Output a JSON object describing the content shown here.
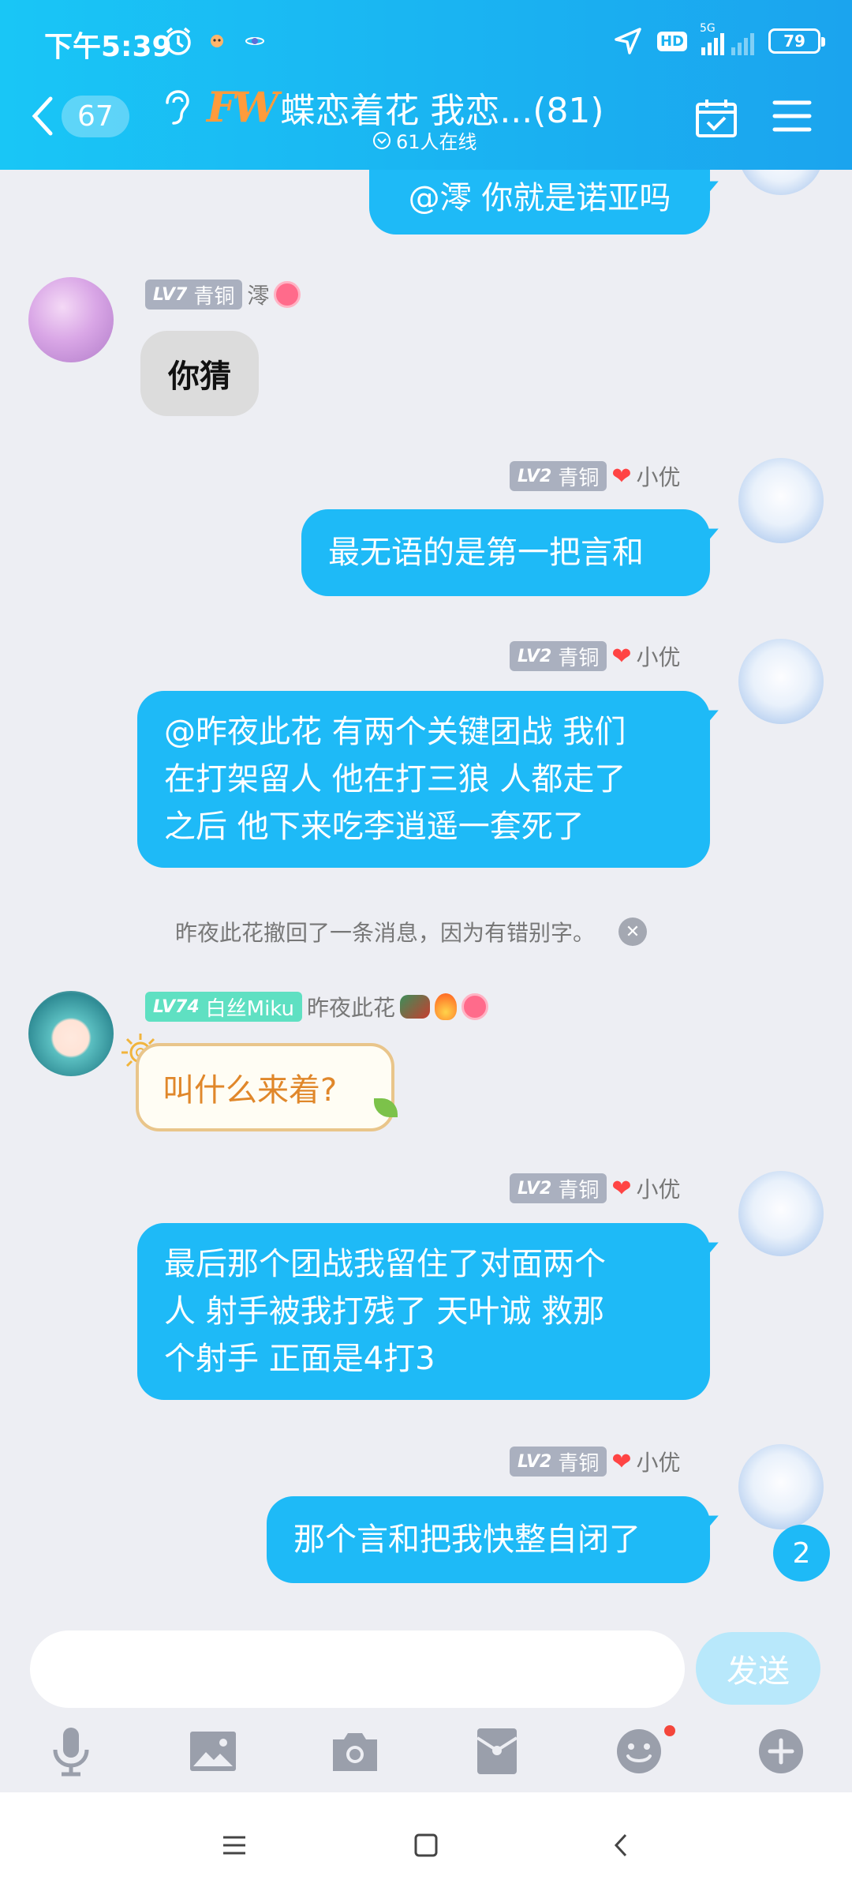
{
  "status_bar": {
    "time": "下午5:39",
    "hd": "HD",
    "net": "5G",
    "battery": "79"
  },
  "header": {
    "back_count": "67",
    "logo_text": "FW",
    "title": "蝶恋着花 我恋...(81)",
    "online": "61人在线"
  },
  "colors": {
    "header_start": "#19c6f6",
    "header_end": "#1ba4ee",
    "bubble_self": "#1ebaf7",
    "bubble_other": "#dcdcdc"
  },
  "messages": [
    {
      "side": "right",
      "text": "@澪 你就是诺亚吗"
    },
    {
      "side": "left",
      "level": "LV7",
      "rank": "青铜",
      "name": "澪",
      "text": "你猜"
    },
    {
      "side": "right",
      "level": "LV2",
      "rank": "青铜",
      "name": "小优",
      "text": "最无语的是第一把言和"
    },
    {
      "side": "right",
      "level": "LV2",
      "rank": "青铜",
      "name": "小优",
      "lines": [
        "@昨夜此花 有两个关键团战 我们",
        "在打架留人 他在打三狼 人都走了",
        "之后 他下来吃李逍遥一套死了"
      ]
    },
    {
      "side": "left",
      "level": "LV74",
      "rank": "白丝Miku",
      "name": "昨夜此花",
      "text": "叫什么来着?"
    },
    {
      "side": "right",
      "level": "LV2",
      "rank": "青铜",
      "name": "小优",
      "lines": [
        "最后那个团战我留住了对面两个",
        "人 射手被我打残了 天叶诚 救那",
        "个射手 正面是4打3"
      ]
    },
    {
      "side": "right",
      "level": "LV2",
      "rank": "青铜",
      "name": "小优",
      "text": "那个言和把我快整自闭了"
    }
  ],
  "recall_notice": "昨夜此花撤回了一条消息，因为有错别字。",
  "unread_count": "2",
  "input": {
    "placeholder": "",
    "send_label": "发送"
  },
  "toolbar_icons": [
    "mic-icon",
    "image-icon",
    "camera-icon",
    "red-packet-icon",
    "emoji-icon",
    "plus-icon"
  ]
}
